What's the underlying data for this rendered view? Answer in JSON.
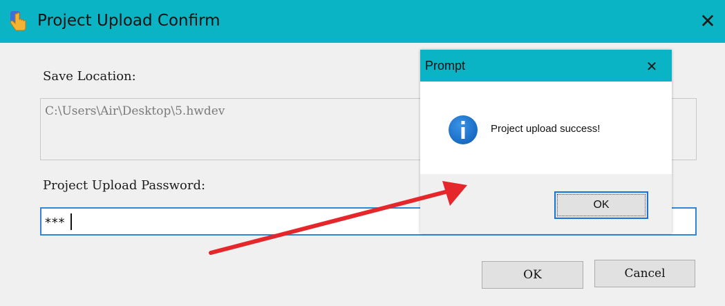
{
  "main_window": {
    "title": "Project Upload Confirm",
    "close_glyph": "✕",
    "save_location_label": "Save Location:",
    "save_location_value": "C:\\Users\\Air\\Desktop\\5.hwdev",
    "password_label": "Project Upload Password:",
    "password_value": "***",
    "ok_label": "OK",
    "cancel_label": "Cancel"
  },
  "prompt_dialog": {
    "title": "Prompt",
    "close_glyph": "✕",
    "message": "Project upload success!",
    "ok_label": "OK"
  },
  "colors": {
    "titlebar": "#0ab4c4",
    "focus_border": "#2f86d8",
    "info_icon": "#1673c8",
    "annotation_arrow": "#e5262b"
  },
  "icons": {
    "app_icon": "hand-pointer-icon",
    "info_icon": "info-icon"
  }
}
